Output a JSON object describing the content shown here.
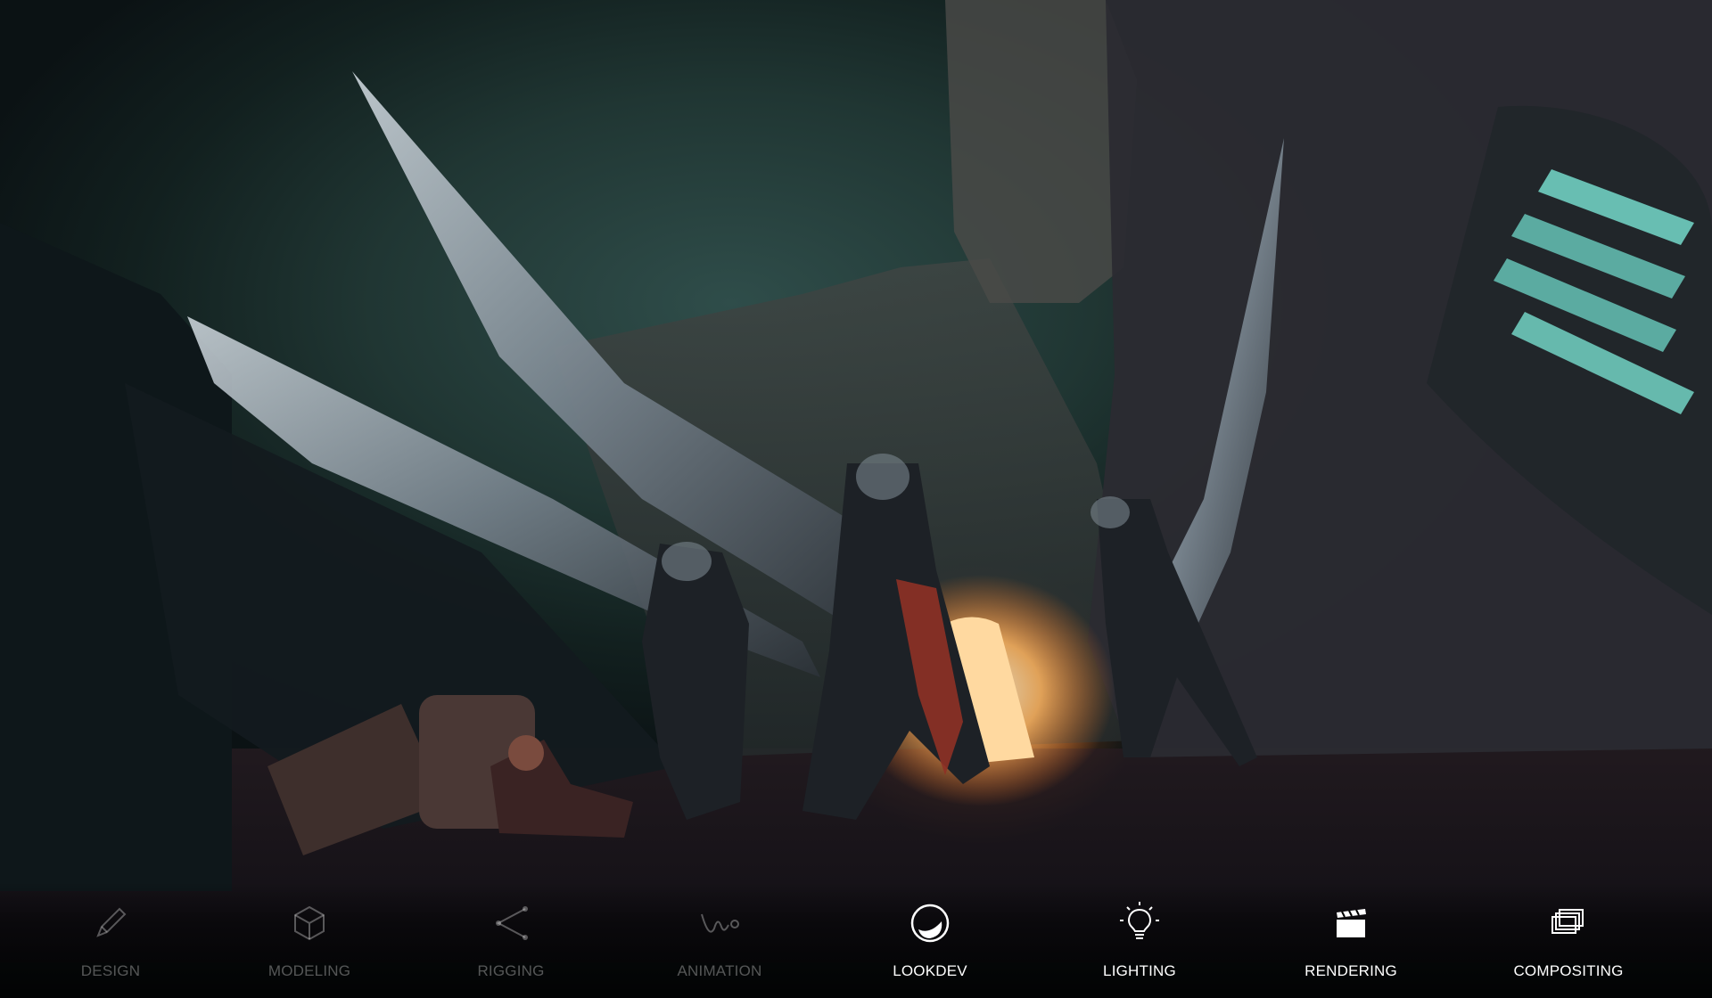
{
  "scene": {
    "image_alt": "Animated fortress scene with armored knights holding giant blades and a glowing doorway"
  },
  "dock": {
    "items": [
      {
        "label": "DESIGN",
        "icon": "pencil-icon",
        "state": "dimmed"
      },
      {
        "label": "MODELING",
        "icon": "cube-icon",
        "state": "dimmed"
      },
      {
        "label": "RIGGING",
        "icon": "rig-joint-icon",
        "state": "dimmed"
      },
      {
        "label": "ANIMATION",
        "icon": "motion-path-icon",
        "state": "dimmed"
      },
      {
        "label": "LOOKDEV",
        "icon": "shaded-sphere-icon",
        "state": "active"
      },
      {
        "label": "LIGHTING",
        "icon": "lightbulb-icon",
        "state": "active"
      },
      {
        "label": "RENDERING",
        "icon": "clapperboard-icon",
        "state": "active"
      },
      {
        "label": "COMPOSITING",
        "icon": "stacked-layers-icon",
        "state": "active"
      }
    ]
  },
  "colors": {
    "active_text": "#ffffff",
    "dimmed_text": "rgba(255,255,255,0.32)",
    "door_glow": "#ffb560"
  }
}
